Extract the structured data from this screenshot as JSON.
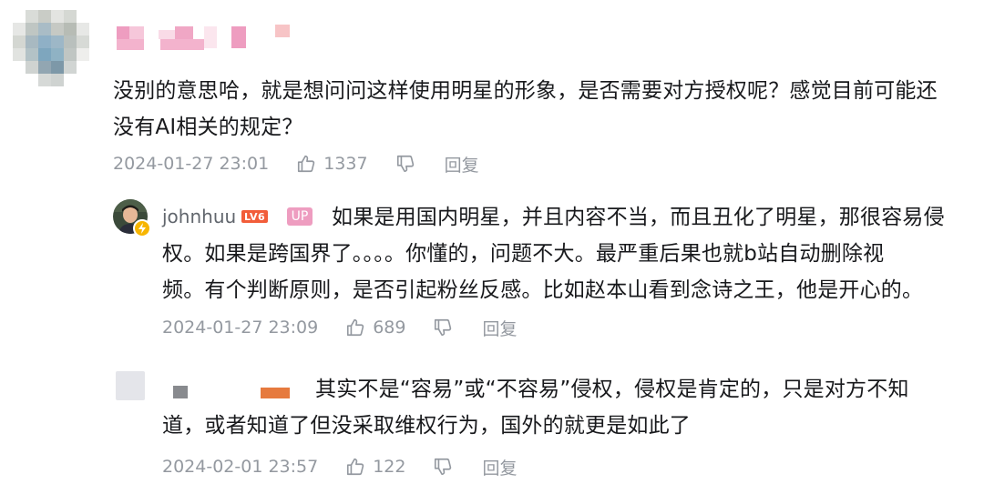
{
  "colors": {
    "text": "#18191c",
    "meta": "#9499a0",
    "level_badge": "#f25d3a",
    "up_badge": "#ee9dc0"
  },
  "main_comment": {
    "text_line1": "没别的意思哈，就是想问问这样使用明星的形象，是否需要对方授权呢？感觉目前可能还",
    "text_line2": "没有AI相关的规定？",
    "time": "2024-01-27 23:01",
    "likes": "1337",
    "reply_label": "回复"
  },
  "reply1": {
    "username": "johnhuu",
    "level_badge": "LV6",
    "up_badge": "UP",
    "text_line1": "如果是用国内明星，并且内容不当，而且丑化了明星，那很容易侵",
    "text_line2": "权。如果是跨国界了。。。。你懂的，问题不大。最严重后果也就b站自动删除视",
    "text_line3": "频。有个判断原则，是否引起粉丝反感。比如赵本山看到念诗之王，他是开心的。",
    "time": "2024-01-27 23:09",
    "likes": "689",
    "reply_label": "回复"
  },
  "reply2": {
    "text_line1": "其实不是“容易”或“不容易”侵权，侵权是肯定的，只是对方不知",
    "text_line2": "道，或者知道了但没采取维权行为，国外的就更是如此了",
    "time": "2024-02-01 23:57",
    "likes": "122",
    "reply_label": "回复"
  }
}
